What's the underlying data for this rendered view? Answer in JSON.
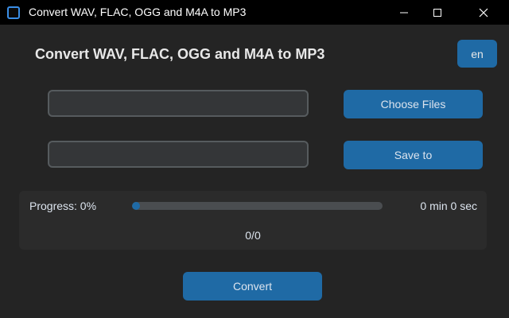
{
  "window": {
    "title": "Convert WAV, FLAC, OGG and M4A to MP3"
  },
  "header": {
    "title": "Convert WAV, FLAC, OGG and M4A to MP3",
    "language_button": "en"
  },
  "files": {
    "input_value": "",
    "choose_label": "Choose Files"
  },
  "output": {
    "input_value": "",
    "save_label": "Save to"
  },
  "progress": {
    "label": "Progress: 0%",
    "fraction": 0,
    "time_remaining": "0 min 0 sec",
    "count": "0/0"
  },
  "actions": {
    "convert_label": "Convert"
  },
  "colors": {
    "accent": "#1f6aa5",
    "background": "#242424",
    "frame": "#2b2b2b",
    "titlebar": "#000000"
  },
  "icons": {
    "app": "app-icon",
    "minimize": "minimize-icon",
    "maximize": "maximize-icon",
    "close": "close-icon"
  }
}
